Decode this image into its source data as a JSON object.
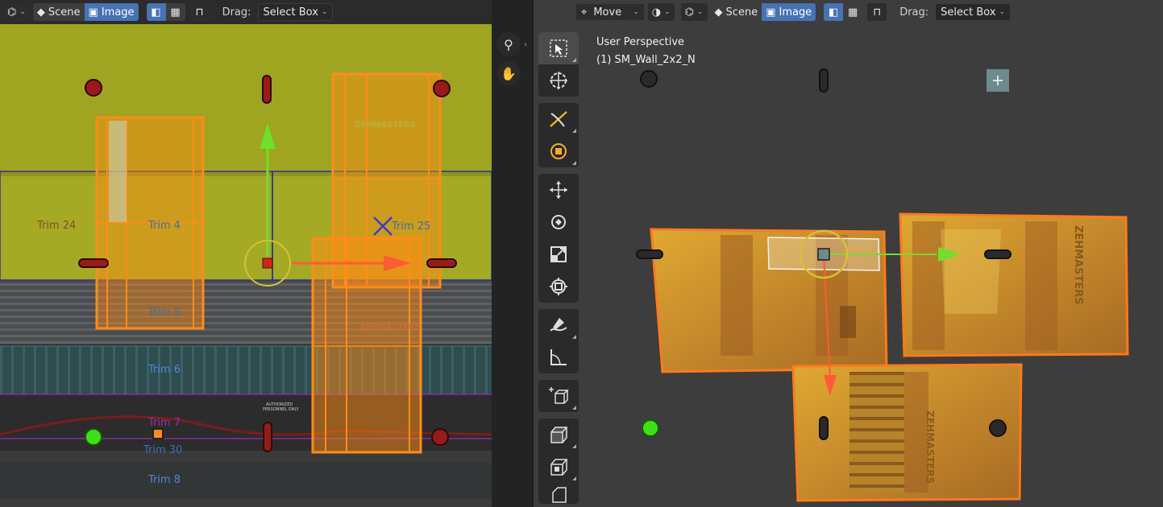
{
  "uv_editor": {
    "header": {
      "scene_label": "Scene",
      "image_label": "Image",
      "drag_label": "Drag:",
      "drag_value": "Select Box"
    },
    "trims": [
      {
        "name": "Trim 24",
        "color": "#8a4b2a"
      },
      {
        "name": "Trim 4",
        "color": "#3d6fa8"
      },
      {
        "name": "Trim 25",
        "color": "#3d6fa8"
      },
      {
        "name": "Trim 5",
        "color": "#3d6fa8"
      },
      {
        "name": "Trim 6",
        "color": "#3d6fa8"
      },
      {
        "name": "Trim 7",
        "color": "#9a2fa0"
      },
      {
        "name": "Trim 30",
        "color": "#3d6fa8"
      },
      {
        "name": "Trim 8",
        "color": "#3d6fa8"
      }
    ],
    "texture_text": {
      "brand": "ZEHMASTERS",
      "small_lines": [
        "AUTHORIZED",
        "PERSONNEL ONLY"
      ]
    },
    "nav_icons": [
      "zoom-icon",
      "hand-icon"
    ]
  },
  "viewport": {
    "header": {
      "transform_value": "Move",
      "scene_label": "Scene",
      "image_label": "Image",
      "drag_label": "Drag:",
      "drag_value": "Select Box"
    },
    "info": {
      "perspective": "User Perspective",
      "object": "(1) SM_Wall_2x2_N"
    },
    "tools": [
      [
        "select-box-tool",
        "cursor-tool"
      ],
      [
        "rip-tool",
        "grab-proportional-tool"
      ],
      [
        "move-tool",
        "rotate-tool",
        "scale-tool",
        "transform-tool"
      ],
      [
        "annotate-tool",
        "measure-tool"
      ],
      [
        "add-cube-tool"
      ],
      [
        "extrude-tool",
        "inset-tool",
        "bevel-tool"
      ]
    ]
  },
  "colors": {
    "accent": "#4772b3",
    "selection_orange": "#ff8c1a",
    "axis_x": "#ff5a36",
    "axis_y": "#6ee02a",
    "gizmo_ring": "#d6c234"
  }
}
